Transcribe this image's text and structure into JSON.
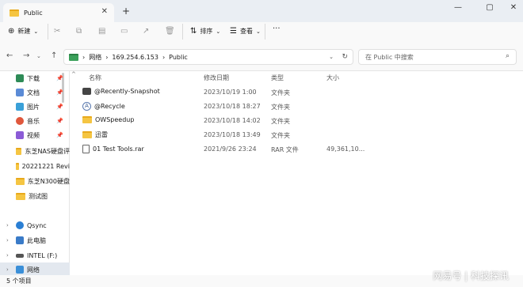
{
  "window": {
    "tab_title": "Public",
    "new_tab": "+",
    "minimize": "—",
    "maximize": "▢",
    "close": "✕"
  },
  "toolbar": {
    "new_label": "新建",
    "sort_label": "排序",
    "view_label": "查看",
    "more": "···"
  },
  "address": {
    "segments": [
      "网络",
      "169.254.6.153",
      "Public"
    ],
    "sep": "›"
  },
  "search": {
    "placeholder": "在 Public 中搜索"
  },
  "sidebar": {
    "items": [
      {
        "label": "下载",
        "pinned": true,
        "color": "#2e8b57"
      },
      {
        "label": "文档",
        "pinned": true,
        "color": "#5b8bd6"
      },
      {
        "label": "图片",
        "pinned": true,
        "color": "#3aa0d8"
      },
      {
        "label": "音乐",
        "pinned": true,
        "color": "#e0573c"
      },
      {
        "label": "视频",
        "pinned": true,
        "color": "#8b5bd6"
      },
      {
        "label": "东芝NAS硬盘评",
        "pinned": false,
        "color": "#f5c542"
      },
      {
        "label": "20221221 Revi",
        "pinned": false,
        "color": "#f5c542"
      },
      {
        "label": "东芝N300硬盘",
        "pinned": false,
        "color": "#f5c542"
      },
      {
        "label": "测试图",
        "pinned": false,
        "color": "#f5c542"
      }
    ],
    "locations": [
      {
        "label": "Qsync",
        "color": "#2a7fd4"
      },
      {
        "label": "此电脑",
        "color": "#3a7bc8"
      },
      {
        "label": "INTEL (F:)",
        "color": "#555555"
      },
      {
        "label": "网络",
        "color": "#3a8fd8"
      }
    ]
  },
  "columns": {
    "name": "名称",
    "date": "修改日期",
    "type": "类型",
    "size": "大小"
  },
  "files": [
    {
      "name": "@Recently-Snapshot",
      "date": "2023/10/19 1:00",
      "type": "文件夹",
      "size": "",
      "icon": "camera-icon"
    },
    {
      "name": "@Recycle",
      "date": "2023/10/18 18:27",
      "type": "文件夹",
      "size": "",
      "icon": "recycle-icon"
    },
    {
      "name": "OWSpeedup",
      "date": "2023/10/18 14:02",
      "type": "文件夹",
      "size": "",
      "icon": "folder-icon"
    },
    {
      "name": "迅雷",
      "date": "2023/10/18 13:49",
      "type": "文件夹",
      "size": "",
      "icon": "folder-icon"
    },
    {
      "name": "01 Test Tools.rar",
      "date": "2021/9/26 23:24",
      "type": "RAR 文件",
      "size": "49,361,10...",
      "icon": "file-icon"
    }
  ],
  "status": {
    "count": "5 个项目"
  },
  "watermark": "网易号 | 科技探讯"
}
